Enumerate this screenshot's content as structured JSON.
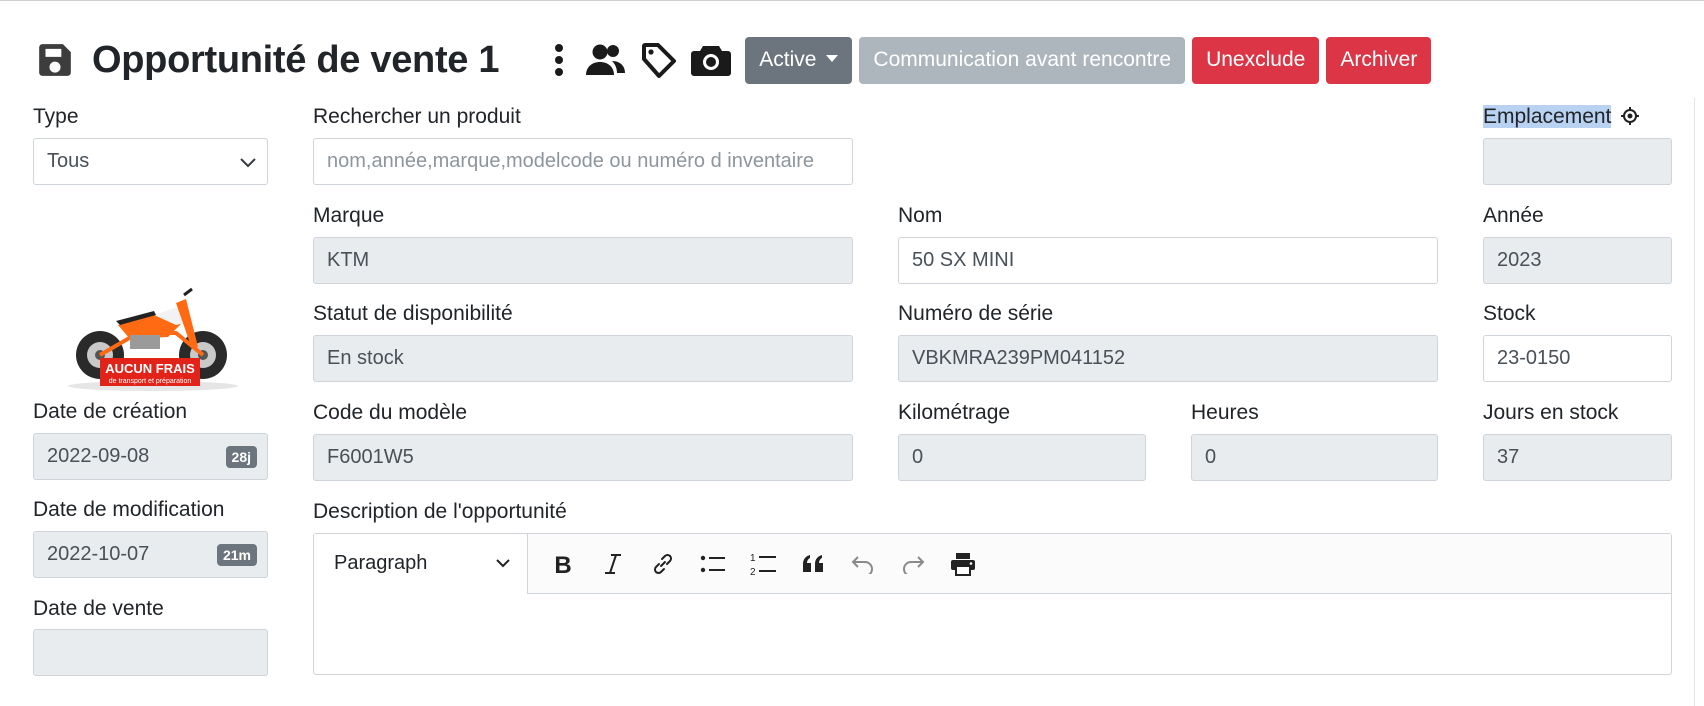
{
  "header": {
    "title": "Opportunité de vente 1",
    "status_label": "Active",
    "communication_label": "Communication avant rencontre",
    "unexclude_label": "Unexclude",
    "archive_label": "Archiver",
    "icons": [
      "save-icon",
      "more-vertical-icon",
      "users-icon",
      "tag-icon",
      "camera-icon"
    ]
  },
  "left": {
    "type_label": "Type",
    "type_value": "Tous",
    "product_image_text": "AUCUN FRAIS",
    "product_image_subtext": "de transport et préparation",
    "created_label": "Date de création",
    "created_value": "2022-09-08",
    "created_badge": "28j",
    "modified_label": "Date de modification",
    "modified_value": "2022-10-07",
    "modified_badge": "21m",
    "sale_label": "Date de vente",
    "sale_value": ""
  },
  "form": {
    "search_label": "Rechercher un produit",
    "search_placeholder": "nom,année,marque,modelcode ou numéro d inventaire",
    "location_label": "Emplacement",
    "location_value": "",
    "brand_label": "Marque",
    "brand_value": "KTM",
    "name_label": "Nom",
    "name_value": "50 SX MINI",
    "year_label": "Année",
    "year_value": "2023",
    "availability_label": "Statut de disponibilité",
    "availability_value": "En stock",
    "serial_label": "Numéro de série",
    "serial_value": "VBKMRA239PM041152",
    "stock_label": "Stock",
    "stock_value": "23-0150",
    "model_code_label": "Code du modèle",
    "model_code_value": "F6001W5",
    "mileage_label": "Kilométrage",
    "mileage_value": "0",
    "hours_label": "Heures",
    "hours_value": "0",
    "days_label": "Jours en stock",
    "days_value": "37",
    "description_label": "Description de l'opportunité"
  },
  "editor": {
    "paragraph_label": "Paragraph",
    "tools": [
      "bold-icon",
      "italic-icon",
      "link-icon",
      "bullet-list-icon",
      "numbered-list-icon",
      "blockquote-icon",
      "undo-icon",
      "redo-icon",
      "print-icon"
    ]
  },
  "colors": {
    "status_button": "#6c757d",
    "secondary_button": "#adb5bd",
    "danger_button": "#dc3545",
    "readonly_field": "#e9ecef",
    "selection_highlight": "#b9d2f2"
  }
}
